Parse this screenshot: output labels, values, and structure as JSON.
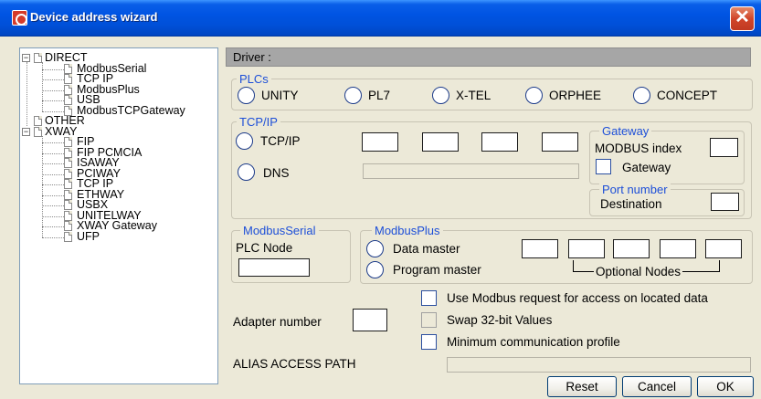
{
  "window": {
    "title": "Device address wizard",
    "close_glyph": "✕"
  },
  "tree": {
    "expanded_glyph": "−",
    "items": [
      {
        "label": "DIRECT",
        "level": 0,
        "expandable": true
      },
      {
        "label": "ModbusSerial",
        "level": 1
      },
      {
        "label": "TCP IP",
        "level": 1
      },
      {
        "label": "ModbusPlus",
        "level": 1
      },
      {
        "label": "USB",
        "level": 1
      },
      {
        "label": "ModbusTCPGateway",
        "level": 1
      },
      {
        "label": "OTHER",
        "level": 0,
        "expandable": false
      },
      {
        "label": "XWAY",
        "level": 0,
        "expandable": true
      },
      {
        "label": "FIP",
        "level": 1
      },
      {
        "label": "FIP PCMCIA",
        "level": 1
      },
      {
        "label": "ISAWAY",
        "level": 1
      },
      {
        "label": "PCIWAY",
        "level": 1
      },
      {
        "label": "TCP IP",
        "level": 1
      },
      {
        "label": "ETHWAY",
        "level": 1
      },
      {
        "label": "USBX",
        "level": 1
      },
      {
        "label": "UNITELWAY",
        "level": 1
      },
      {
        "label": "XWAY Gateway",
        "level": 1
      },
      {
        "label": "UFP",
        "level": 1
      }
    ]
  },
  "driver": {
    "label": "Driver :"
  },
  "plcs": {
    "legend": "PLCs",
    "options": [
      "UNITY",
      "PL7",
      "X-TEL",
      "ORPHEE",
      "CONCEPT"
    ]
  },
  "tcpip": {
    "legend": "TCP/IP",
    "tcpip_label": "TCP/IP",
    "dns_label": "DNS"
  },
  "gateway": {
    "legend": "Gateway",
    "modbus_index_label": "MODBUS index",
    "gateway_checkbox_label": "Gateway"
  },
  "port_number": {
    "legend": "Port number",
    "destination_label": "Destination"
  },
  "modbus_serial": {
    "legend": "ModbusSerial",
    "plc_node_label": "PLC Node"
  },
  "modbus_plus": {
    "legend": "ModbusPlus",
    "data_master_label": "Data master",
    "program_master_label": "Program master",
    "optional_nodes_label": "Optional Nodes"
  },
  "options": {
    "adapter_number_label": "Adapter number",
    "use_modbus_label": "Use Modbus request for access on located data",
    "swap_label": "Swap 32-bit Values",
    "min_comm_label": "Minimum communication profile",
    "alias_label": "ALIAS ACCESS PATH"
  },
  "buttons": {
    "reset": "Reset",
    "cancel": "Cancel",
    "ok": "OK"
  },
  "colors": {
    "legend_blue": "#1d4fd8",
    "title_blue": "#0054e3",
    "close_red": "#d0452a"
  }
}
